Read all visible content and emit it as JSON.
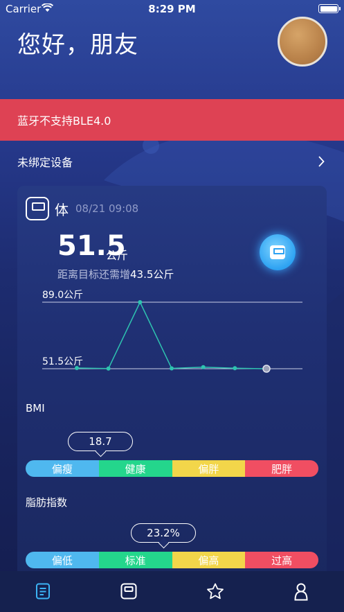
{
  "status_bar": {
    "carrier": "Carrier",
    "time": "8:29 PM"
  },
  "header": {
    "greeting": "您好，朋友"
  },
  "alert": {
    "text": "蓝牙不支持BLE4.0"
  },
  "device": {
    "label": "未绑定设备"
  },
  "weight_card": {
    "title": "体",
    "datetime": "08/21 09:08",
    "value": "51.5",
    "unit": "公斤",
    "tip_prefix": "距离目标还需增",
    "tip_value": "43.5公斤",
    "chart": {
      "max_label": "89.0公斤",
      "min_label": "51.5公斤",
      "points": [
        51.9,
        51.6,
        89.0,
        51.7,
        52.4,
        51.8,
        51.5
      ]
    }
  },
  "bmi": {
    "label": "BMI",
    "value": "18.7",
    "segments": [
      "偏瘦",
      "健康",
      "偏胖",
      "肥胖"
    ],
    "colors": [
      "#4fb8ef",
      "#24d68c",
      "#f2d64a",
      "#f04e62"
    ]
  },
  "fat": {
    "label": "脂肪指数",
    "value": "23.2%",
    "segments": [
      "偏低",
      "标准",
      "偏高",
      "过高"
    ],
    "colors": [
      "#4fb8ef",
      "#24d68c",
      "#f2d64a",
      "#f04e62"
    ]
  },
  "tabs": [
    "document-icon",
    "scale-icon",
    "star-icon",
    "user-icon"
  ]
}
